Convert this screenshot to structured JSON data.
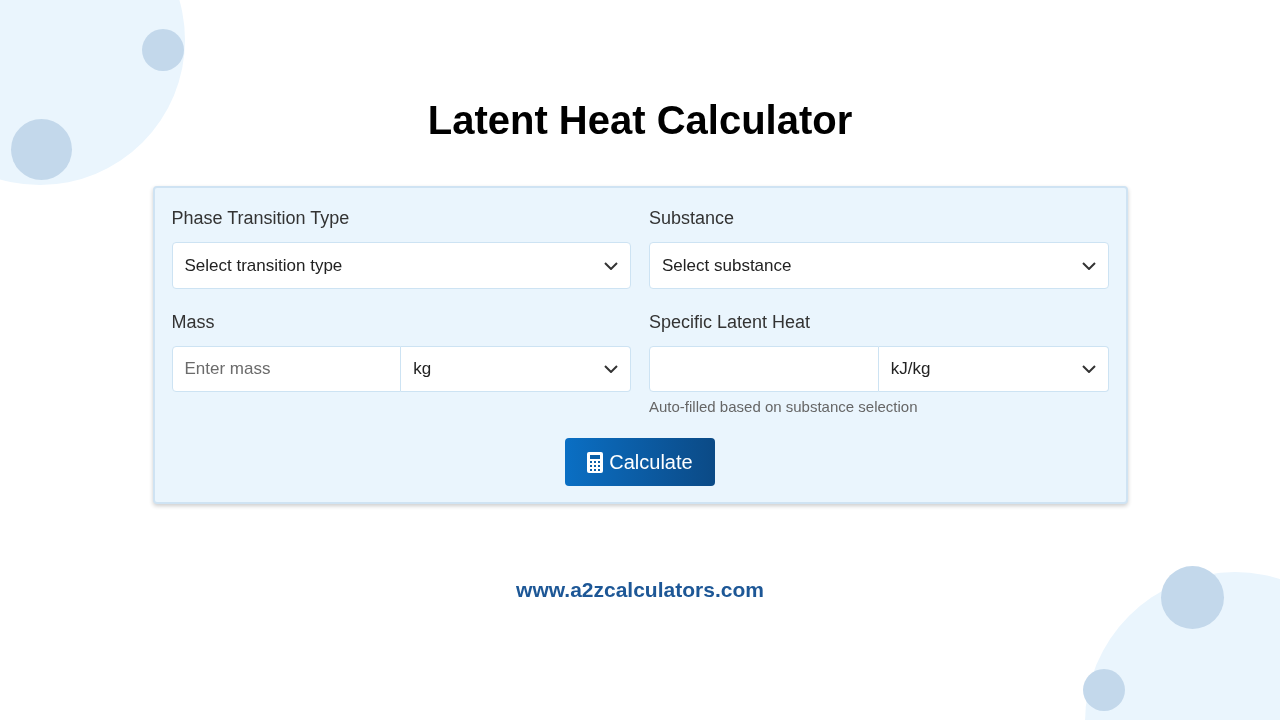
{
  "title": "Latent Heat Calculator",
  "form": {
    "fields": [
      {
        "kind": "select",
        "label": "Phase Transition Type",
        "value": "Select transition type"
      },
      {
        "kind": "select",
        "label": "Substance",
        "value": "Select substance"
      },
      {
        "kind": "amount",
        "label": "Mass",
        "placeholder": "Enter mass",
        "unit": "kg"
      },
      {
        "kind": "amount",
        "label": "Specific Latent Heat",
        "unit": "kJ/kg",
        "hint": "Auto-filled based on substance selection"
      }
    ],
    "button": {
      "label": "Calculate"
    }
  },
  "footer": {
    "url": "www.a2zcalculators.com"
  }
}
